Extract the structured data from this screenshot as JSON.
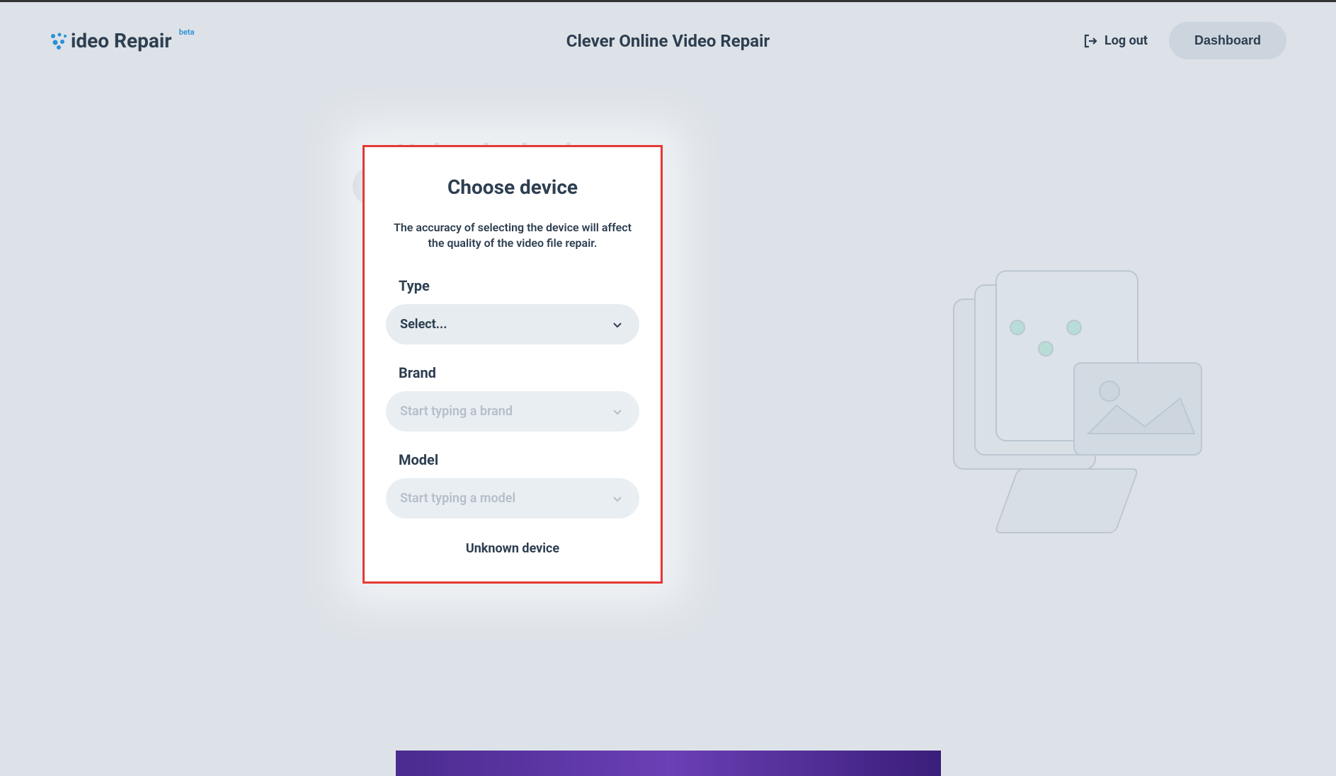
{
  "header": {
    "logo_text": "ideo Repair",
    "logo_badge": "beta",
    "page_title": "Clever Online Video Repair",
    "logout_label": "Log out",
    "dashboard_label": "Dashboard"
  },
  "backdrop": {
    "heading": "Upload a broken"
  },
  "modal": {
    "title": "Choose device",
    "description": "The accuracy of selecting the device will affect the quality of the video file repair.",
    "fields": {
      "type": {
        "label": "Type",
        "placeholder": "Select..."
      },
      "brand": {
        "label": "Brand",
        "placeholder": "Start typing a brand"
      },
      "model": {
        "label": "Model",
        "placeholder": "Start typing a model"
      }
    },
    "unknown_label": "Unknown device"
  }
}
